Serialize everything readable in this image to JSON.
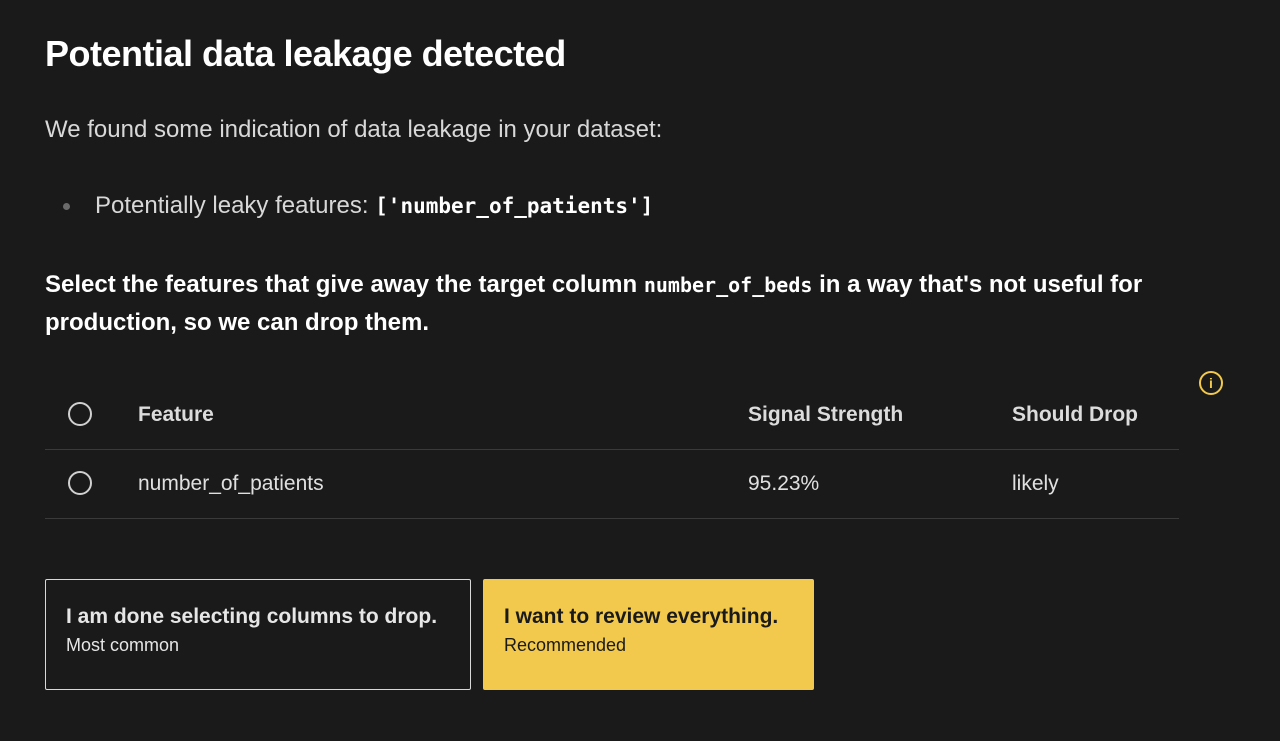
{
  "page": {
    "title": "Potential data leakage detected",
    "intro": "We found some indication of data leakage in your dataset:",
    "bullets": {
      "leaky_label": "Potentially leaky features:",
      "leaky_value": "['number_of_patients']"
    },
    "instruction": {
      "before": "Select the features that give away the target column",
      "target_column": "number_of_beds",
      "after": "in a way that's not useful for production, so we can drop them."
    },
    "info_icon": "i"
  },
  "table": {
    "headers": {
      "feature": "Feature",
      "signal": "Signal Strength",
      "drop": "Should Drop"
    },
    "rows": [
      {
        "feature": "number_of_patients",
        "signal": "95.23%",
        "drop": "likely"
      }
    ]
  },
  "actions": {
    "done": {
      "title": "I am done selecting columns to drop.",
      "subtitle": "Most common"
    },
    "review": {
      "title": "I want to review everything.",
      "subtitle": "Recommended"
    }
  },
  "colors": {
    "background": "#1a1a1a",
    "accent": "#f2c94c",
    "text": "#e6e6e6"
  }
}
